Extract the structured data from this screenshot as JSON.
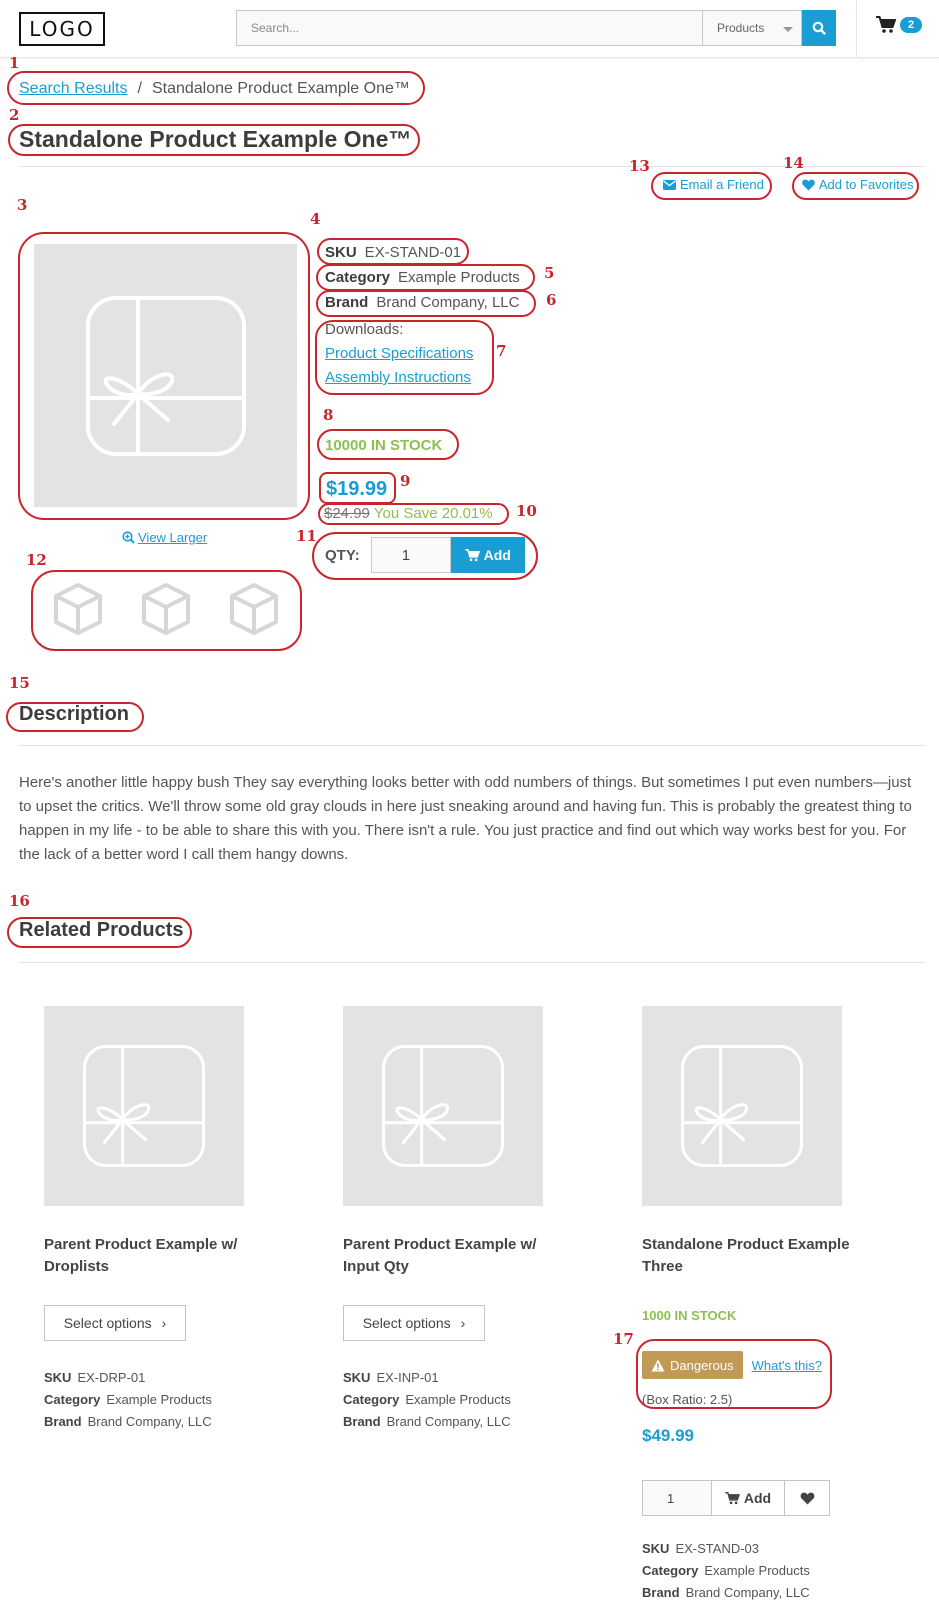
{
  "header": {
    "logo_text": "LOGO",
    "search_placeholder": "Search...",
    "search_scope": "Products",
    "cart_count": "2"
  },
  "breadcrumb": {
    "link": "Search Results",
    "separator": "/",
    "current": "Standalone Product Example One™"
  },
  "product": {
    "title": "Standalone Product Example One™",
    "email_friend": "Email a Friend",
    "add_favorites": "Add to Favorites",
    "view_larger": "View Larger",
    "sku_label": "SKU",
    "sku": "EX-STAND-01",
    "category_label": "Category",
    "category": "Example Products",
    "brand_label": "Brand",
    "brand": "Brand Company, LLC",
    "downloads_label": "Downloads:",
    "downloads": [
      "Product Specifications",
      "Assembly Instructions"
    ],
    "stock": "10000 IN STOCK",
    "price": "$19.99",
    "old_price": "$24.99",
    "savings": "You Save 20.01%",
    "qty_label": "QTY:",
    "qty_value": "1",
    "add_label": "Add",
    "thumbnail_count": 3
  },
  "description": {
    "title": "Description",
    "text": "Here's another little happy bush They say everything looks better with odd numbers of things. But sometimes I put even numbers—just to upset the critics. We'll throw some old gray clouds in here just sneaking around and having fun. This is probably the greatest thing to happen in my life - to be able to share this with you. There isn't a rule. You just practice and find out which way works best for you. For the lack of a better word I call them hangy downs."
  },
  "related": {
    "title": "Related Products",
    "products": [
      {
        "name": "Parent Product Example w/ Droplists",
        "button": "Select options",
        "sku_label": "SKU",
        "sku": "EX-DRP-01",
        "category_label": "Category",
        "category": "Example Products",
        "brand_label": "Brand",
        "brand": "Brand Company, LLC"
      },
      {
        "name": "Parent Product Example w/ Input Qty",
        "button": "Select options",
        "sku_label": "SKU",
        "sku": "EX-INP-01",
        "category_label": "Category",
        "category": "Example Products",
        "brand_label": "Brand",
        "brand": "Brand Company, LLC"
      },
      {
        "name": "Standalone Product Example Three",
        "stock": "1000 IN STOCK",
        "hazmat_label": "Dangerous",
        "hazmat_link": "What's this?",
        "box_ratio": "(Box Ratio: 2.5)",
        "price": "$49.99",
        "qty_value": "1",
        "add_label": "Add",
        "sku_label": "SKU",
        "sku": "EX-STAND-03",
        "category_label": "Category",
        "category": "Example Products",
        "brand_label": "Brand",
        "brand": "Brand Company, LLC"
      }
    ]
  },
  "annotations": [
    "1",
    "2",
    "3",
    "4",
    "5",
    "6",
    "7",
    "8",
    "9",
    "10",
    "11",
    "12",
    "13",
    "14",
    "15",
    "16",
    "17"
  ],
  "colors": {
    "accent": "#1a9dd3",
    "stock_green": "#8dc14f",
    "hazmat": "#c19a55",
    "annotation_red": "#c8262c"
  }
}
